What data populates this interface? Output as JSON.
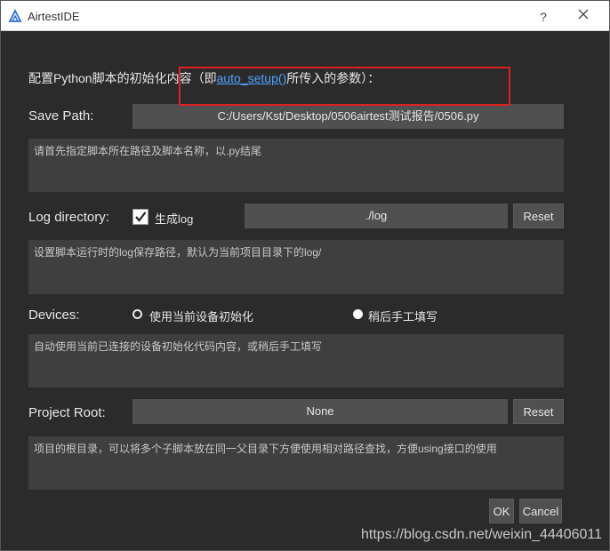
{
  "window": {
    "title": "AirtestIDE",
    "help": "?",
    "accent_color": "#4da3ff",
    "highlight_color": "#e02020"
  },
  "heading": {
    "prefix": "配置Python脚本的初始化内容（即",
    "link": "auto_setup()",
    "suffix": "所传入的参数）："
  },
  "save_path": {
    "label": "Save Path:",
    "value": "C:/Users/Kst/Desktop/0506airtest测试报告/0506.py",
    "description": "请首先指定脚本所在路径及脚本名称，以.py结尾"
  },
  "log_directory": {
    "label": "Log directory:",
    "checkbox_label": "生成log",
    "checked": true,
    "value": "./log",
    "reset": "Reset",
    "description": "设置脚本运行时的log保存路径，默认为当前项目目录下的log/"
  },
  "devices": {
    "label": "Devices:",
    "option_1": "使用当前设备初始化",
    "option_2": "稍后手工填写",
    "selected": "使用当前设备初始化",
    "description": "自动使用当前已连接的设备初始化代码内容，或稍后手工填写"
  },
  "project_root": {
    "label": "Project Root:",
    "value": "None",
    "reset": "Reset",
    "description": "项目的根目录，可以将多个子脚本放在同一父目录下方便使用相对路径查找，方便using接口的使用"
  },
  "footer": {
    "ok": "OK",
    "cancel": "Cancel",
    "watermark": "https://blog.csdn.net/weixin_44406011"
  }
}
